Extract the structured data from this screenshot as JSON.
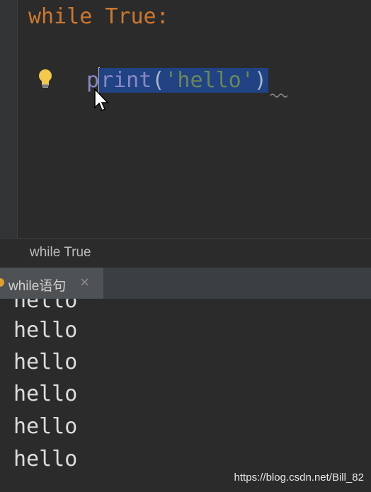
{
  "editor": {
    "line1": {
      "keyword": "while",
      "space": " ",
      "constant": "True",
      "colon": ":"
    },
    "line2": {
      "fn_first": "p",
      "fn_rest": "rint",
      "open_paren": "(",
      "string": "'hello'",
      "close_paren": ")"
    },
    "icons": {
      "intention": "lightbulb-icon",
      "pointer": "mouse-cursor-icon"
    }
  },
  "breadcrumb": {
    "label": "while True"
  },
  "run_tab": {
    "label": "while语句",
    "close": "×"
  },
  "console": {
    "lines": [
      "hello",
      "hello",
      "hello",
      "hello",
      "hello",
      "hello"
    ]
  },
  "watermark": "https://blog.csdn.net/Bill_82",
  "colors": {
    "background": "#2b2b2b",
    "keyword": "#cc7832",
    "string": "#6a8759",
    "selection": "#214283",
    "bulb": "#f2c94c"
  }
}
